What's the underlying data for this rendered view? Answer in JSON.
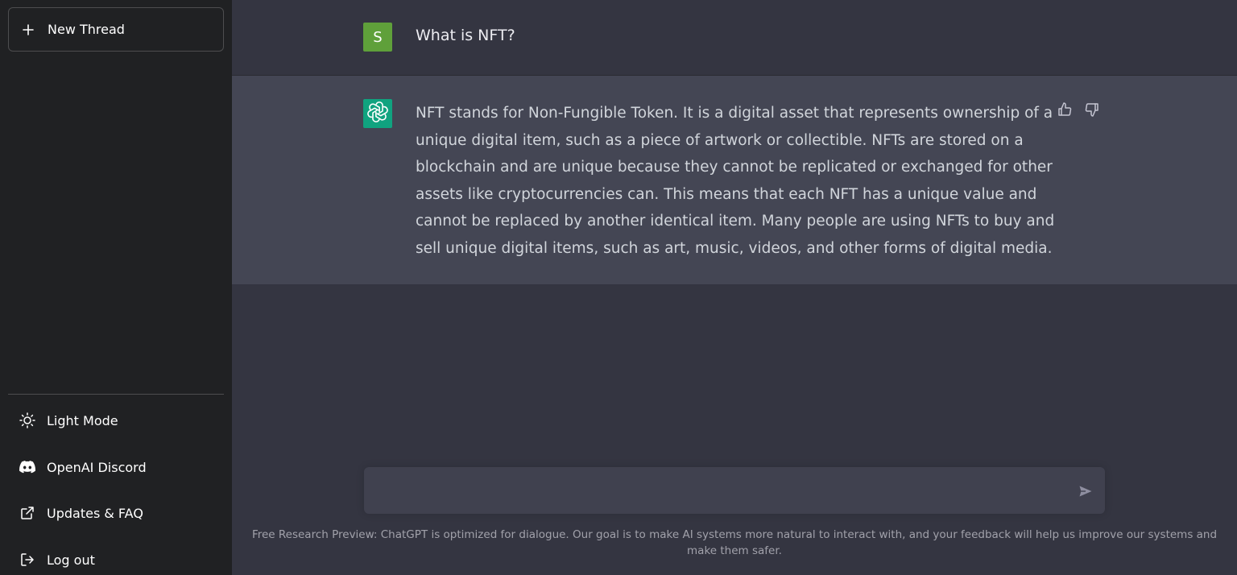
{
  "sidebar": {
    "new_thread_label": "New Thread",
    "menu": {
      "light_mode": "Light Mode",
      "discord": "OpenAI Discord",
      "updates": "Updates & FAQ",
      "logout": "Log out"
    }
  },
  "conversation": {
    "user": {
      "avatar_initial": "S",
      "avatar_color": "#5fa03a",
      "text": "What is NFT?"
    },
    "assistant": {
      "avatar_color": "#10a37f",
      "text": "NFT stands for Non-Fungible Token. It is a digital asset that represents ownership of a unique digital item, such as a piece of artwork or collectible. NFTs are stored on a blockchain and are unique because they cannot be replicated or exchanged for other assets like cryptocurrencies can. This means that each NFT has a unique value and cannot be replaced by another identical item. Many people are using NFTs to buy and sell unique digital items, such as art, music, videos, and other forms of digital media."
    }
  },
  "input": {
    "value": "",
    "placeholder": ""
  },
  "footer": {
    "note": "Free Research Preview: ChatGPT is optimized for dialogue. Our goal is to make AI systems more natural to interact with, and your feedback will help us improve our systems and make them safer."
  },
  "colors": {
    "sidebar_bg": "#202123",
    "main_bg": "#343541",
    "assistant_bg": "#444654",
    "input_bg": "#40414f"
  },
  "icons": [
    "plus-icon",
    "sun-icon",
    "discord-icon",
    "external-link-icon",
    "logout-icon",
    "openai-logo-icon",
    "thumbs-up-icon",
    "thumbs-down-icon",
    "send-icon"
  ]
}
